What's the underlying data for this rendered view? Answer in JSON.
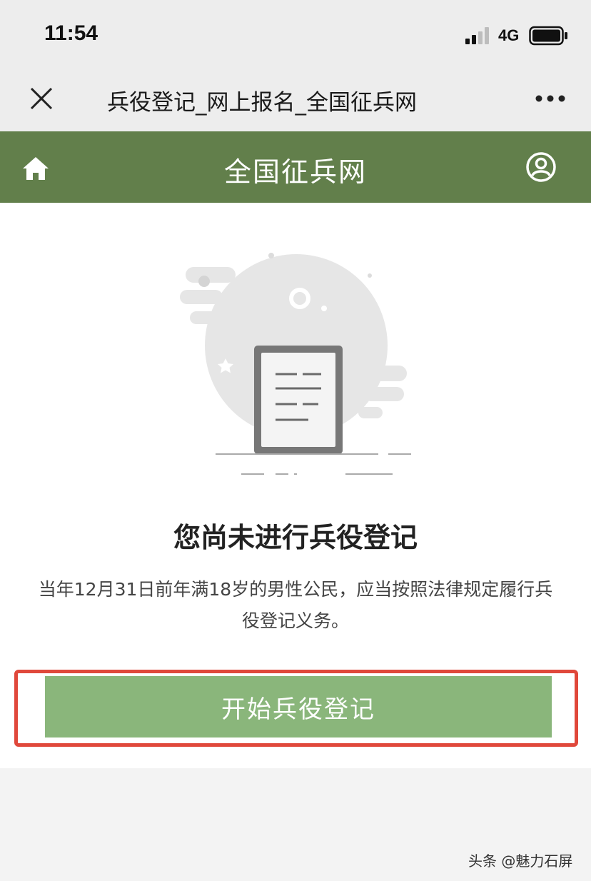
{
  "status_bar": {
    "time": "11:54",
    "network": "4G"
  },
  "webview": {
    "title": "兵役登记_网上报名_全国征兵网",
    "close_icon": "close-icon",
    "more_icon": "more-icon"
  },
  "header": {
    "site_title": "全国征兵网",
    "home_icon": "home-icon",
    "user_icon": "user-icon",
    "color": "#627f4b"
  },
  "main": {
    "illustration_icon": "document-illustration",
    "heading": "您尚未进行兵役登记",
    "description": "当年12月31日前年满18岁的男性公民，应当按照法律规定履行兵役登记义务。",
    "button_label": "开始兵役登记",
    "button_color": "#8ab67b",
    "highlight_color": "#e0483b"
  },
  "watermark": "头条 @魅力石屏"
}
